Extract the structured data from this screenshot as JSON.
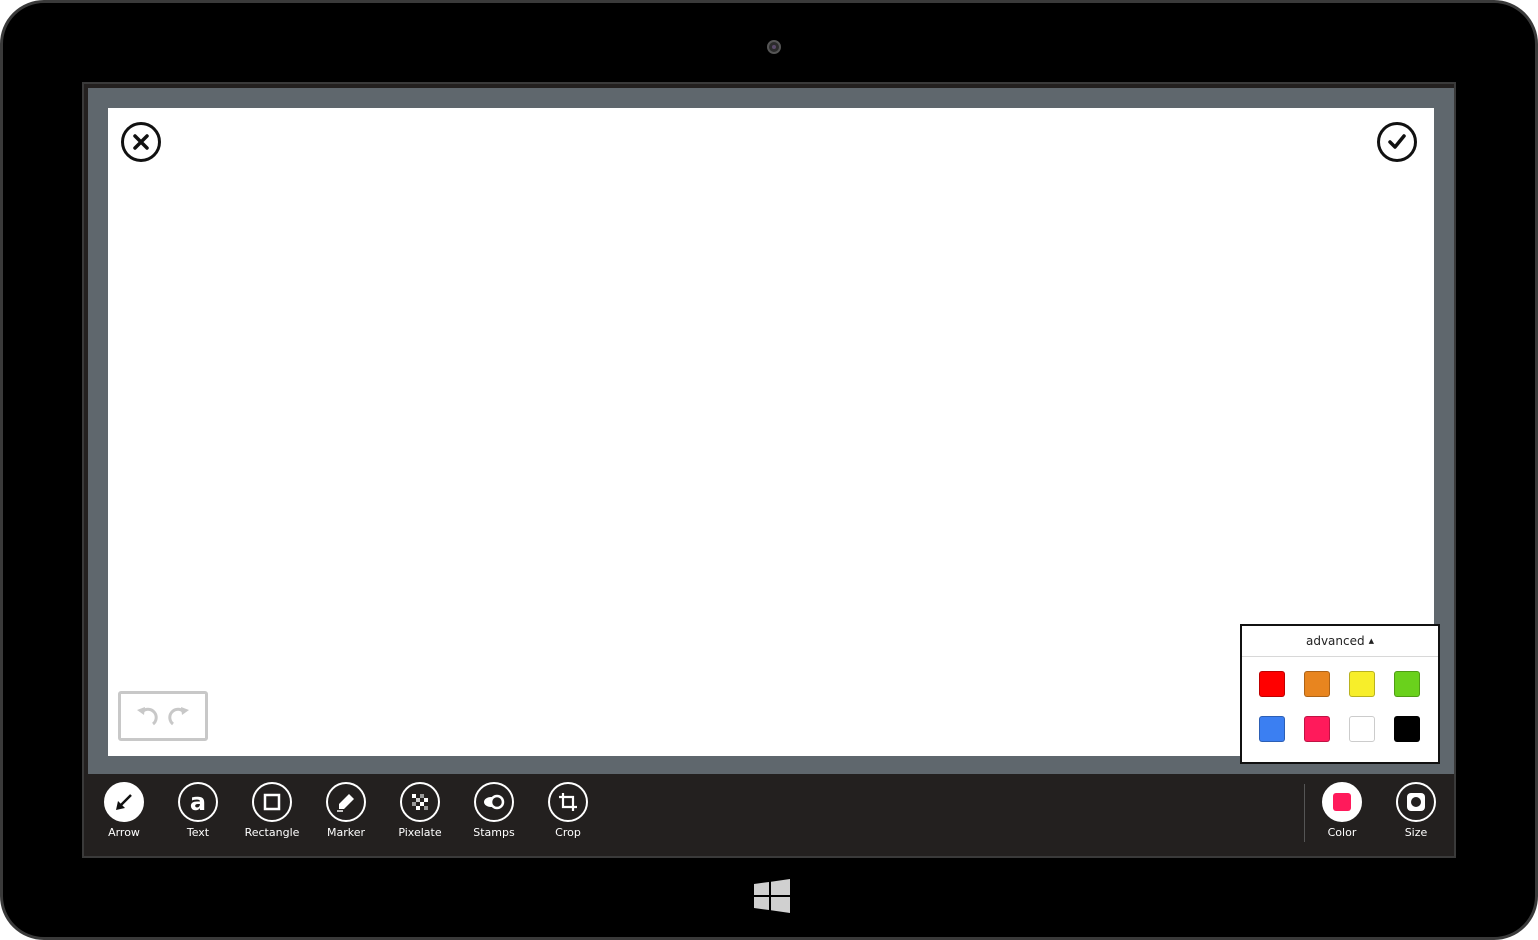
{
  "toolbar": {
    "tools": [
      {
        "label": "Arrow",
        "icon": "arrow-icon",
        "active": true
      },
      {
        "label": "Text",
        "icon": "text-icon",
        "active": false
      },
      {
        "label": "Rectangle",
        "icon": "rectangle-icon",
        "active": false
      },
      {
        "label": "Marker",
        "icon": "marker-icon",
        "active": false
      },
      {
        "label": "Pixelate",
        "icon": "pixelate-icon",
        "active": false
      },
      {
        "label": "Stamps",
        "icon": "stamps-icon",
        "active": false
      },
      {
        "label": "Crop",
        "icon": "crop-icon",
        "active": false
      }
    ],
    "color_label": "Color",
    "size_label": "Size",
    "selected_color": "#ff1a5b"
  },
  "canvas": {
    "close_icon": "close-circle-icon",
    "confirm_icon": "check-circle-icon",
    "undo_icon": "undo-icon",
    "redo_icon": "redo-icon"
  },
  "color_popup": {
    "header": "advanced",
    "caret": "▲",
    "swatches": [
      {
        "name": "red",
        "hex": "#ff0000"
      },
      {
        "name": "orange",
        "hex": "#e8851f"
      },
      {
        "name": "yellow",
        "hex": "#f7ee2a"
      },
      {
        "name": "green",
        "hex": "#6ad11c"
      },
      {
        "name": "blue",
        "hex": "#3b7ff2"
      },
      {
        "name": "pink",
        "hex": "#ff1a5b"
      },
      {
        "name": "white",
        "hex": "#ffffff"
      },
      {
        "name": "black",
        "hex": "#000000"
      }
    ]
  },
  "device": {
    "start_icon": "windows-logo-icon"
  }
}
